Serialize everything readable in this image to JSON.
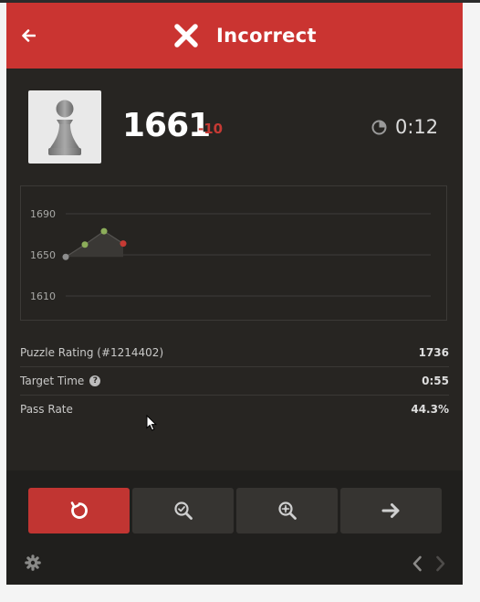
{
  "header": {
    "title": "Incorrect",
    "color": "#ca3431"
  },
  "player": {
    "rating": "1661",
    "delta": "-10",
    "avatar_icon": "pawn-icon"
  },
  "timer": {
    "value": "0:12",
    "icon": "clock-icon"
  },
  "chart_data": {
    "type": "line",
    "ylim": [
      1610,
      1690
    ],
    "yticks": [
      "1690",
      "1650",
      "1610"
    ],
    "points": [
      {
        "y": 1648,
        "color": "#8d8d8d"
      },
      {
        "y": 1660,
        "color": "#8cad5a"
      },
      {
        "y": 1673,
        "color": "#8cad5a"
      },
      {
        "y": 1661,
        "color": "#c63a34"
      }
    ]
  },
  "stats": [
    {
      "label": "Puzzle Rating (#1214402)",
      "value": "1736",
      "help": false
    },
    {
      "label": "Target Time",
      "value": "0:55",
      "help": true
    },
    {
      "label": "Pass Rate",
      "value": "44.3%",
      "help": false
    }
  ],
  "footer": {
    "buttons": [
      "retry-icon",
      "analysis-icon",
      "explore-icon",
      "next-icon"
    ],
    "settings_icon": "gear-icon"
  }
}
